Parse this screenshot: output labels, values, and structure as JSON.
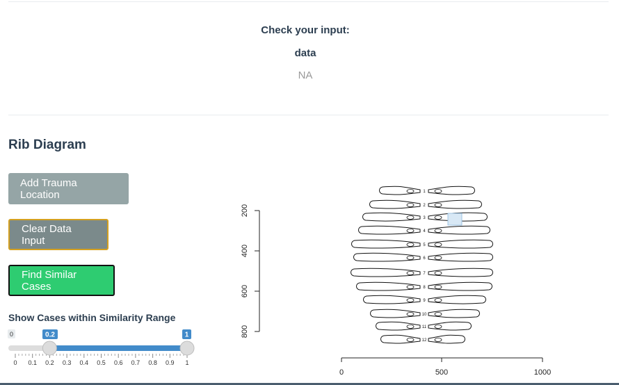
{
  "check": {
    "title": "Check your input:",
    "data_label": "data",
    "data_value": "NA"
  },
  "rib_section": {
    "title": "Rib Diagram"
  },
  "buttons": {
    "add_trauma": "Add Trauma Location",
    "clear_data": "Clear Data Input",
    "find_similar": "Find Similar Cases"
  },
  "slider": {
    "label": "Show Cases within Similarity Range",
    "min_label": "0",
    "from_value": "0.2",
    "to_value": "1",
    "from": 0.2,
    "to": 1,
    "ticks": [
      "0",
      "0.1",
      "0.2",
      "0.3",
      "0.4",
      "0.5",
      "0.6",
      "0.7",
      "0.8",
      "0.9",
      "1"
    ]
  },
  "plot": {
    "y_ticks": [
      "200",
      "400",
      "600",
      "800"
    ],
    "x_ticks": [
      "0",
      "500",
      "1000"
    ],
    "rib_numbers": [
      "1",
      "2",
      "3",
      "4",
      "5",
      "6",
      "7",
      "8",
      "9",
      "10",
      "11",
      "12"
    ]
  },
  "colors": {
    "button_gray": "#95a5a6",
    "button_dark_gray": "#7b8a8b",
    "button_green": "#2ecc71",
    "slider_blue": "#428bca",
    "text": "#2c3e50"
  }
}
